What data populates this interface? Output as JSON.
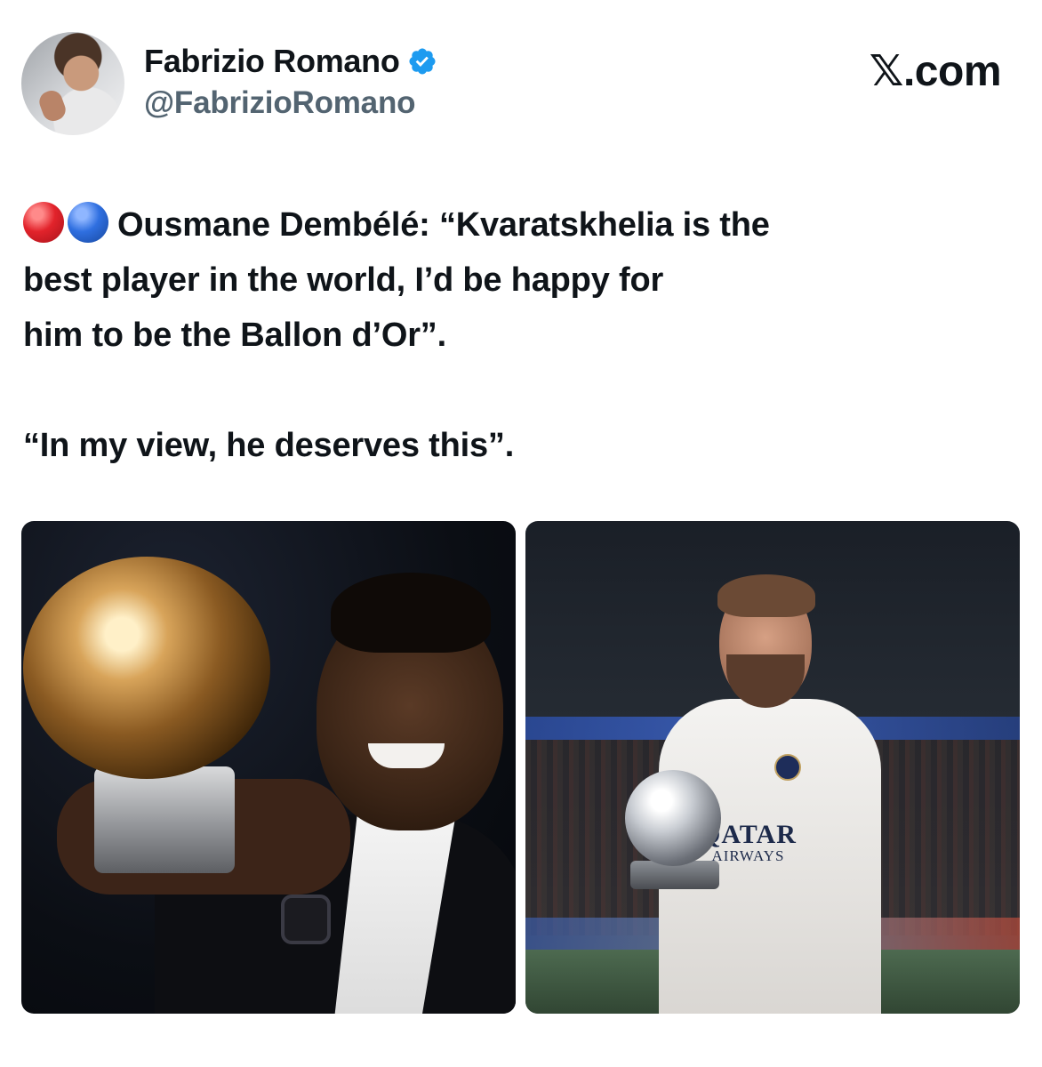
{
  "author": {
    "display_name": "Fabrizio Romano",
    "handle": "@FabrizioRomano",
    "verified": true
  },
  "site": {
    "label": ".com"
  },
  "tweet": {
    "emoji": [
      "red-circle",
      "blue-circle"
    ],
    "line1": "Ousmane Dembélé: “Kvaratskhelia is the",
    "line2": "best player in the world, I’d be happy for",
    "line3": "him to be the Ballon d’Or”.",
    "line4": "“In my view, he deserves this”."
  },
  "media": {
    "right_sponsor_line1": "QATAR",
    "right_sponsor_line2": "AIRWAYS"
  },
  "colors": {
    "text": "#0f1419",
    "secondary": "#536471",
    "verified": "#1d9bf0",
    "red_dot": "#e2232b",
    "blue_dot": "#2f6fe0"
  }
}
